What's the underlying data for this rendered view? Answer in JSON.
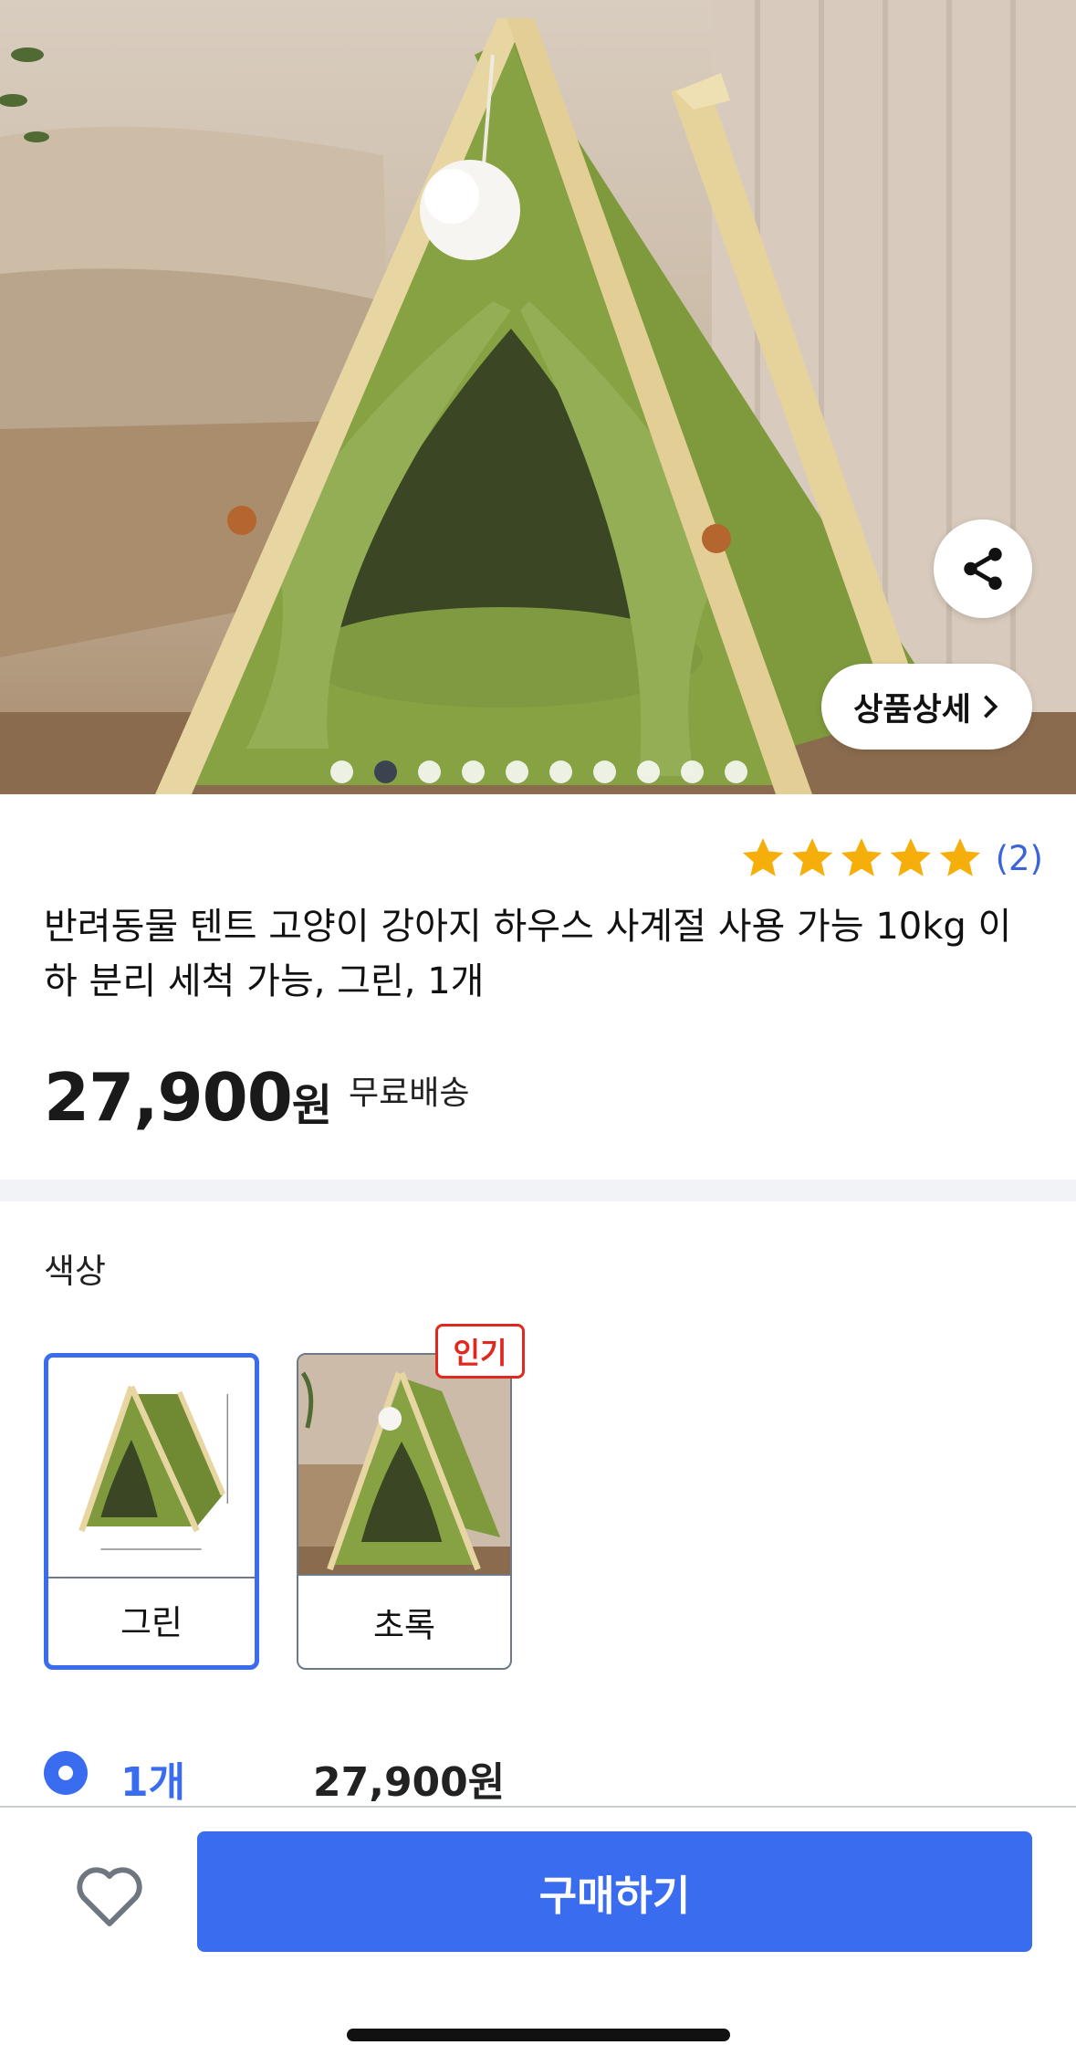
{
  "hero": {
    "detail_button_label": "상품상세",
    "carousel": {
      "total": 10,
      "active_index": 1
    }
  },
  "product": {
    "rating": {
      "stars": 5,
      "count_label": "(2)"
    },
    "title": "반려동물 텐트 고양이 강아지 하우스 사계절 사용 가능 10kg 이하 분리 세척 가능, 그린, 1개",
    "price": "27,900",
    "price_unit": "원",
    "shipping": "무료배송"
  },
  "options": {
    "label": "색상",
    "items": [
      {
        "label": "그린",
        "selected": true
      },
      {
        "label": "초록",
        "selected": false,
        "badge": "인기"
      }
    ]
  },
  "quantity": {
    "label": "1개",
    "price": "27,900원"
  },
  "bottom_bar": {
    "buy_label": "구매하기"
  },
  "colors": {
    "accent": "#3a6cf0",
    "star": "#f6ae0b",
    "badge": "#e0281e",
    "tent_green": "#7e9a3d"
  }
}
